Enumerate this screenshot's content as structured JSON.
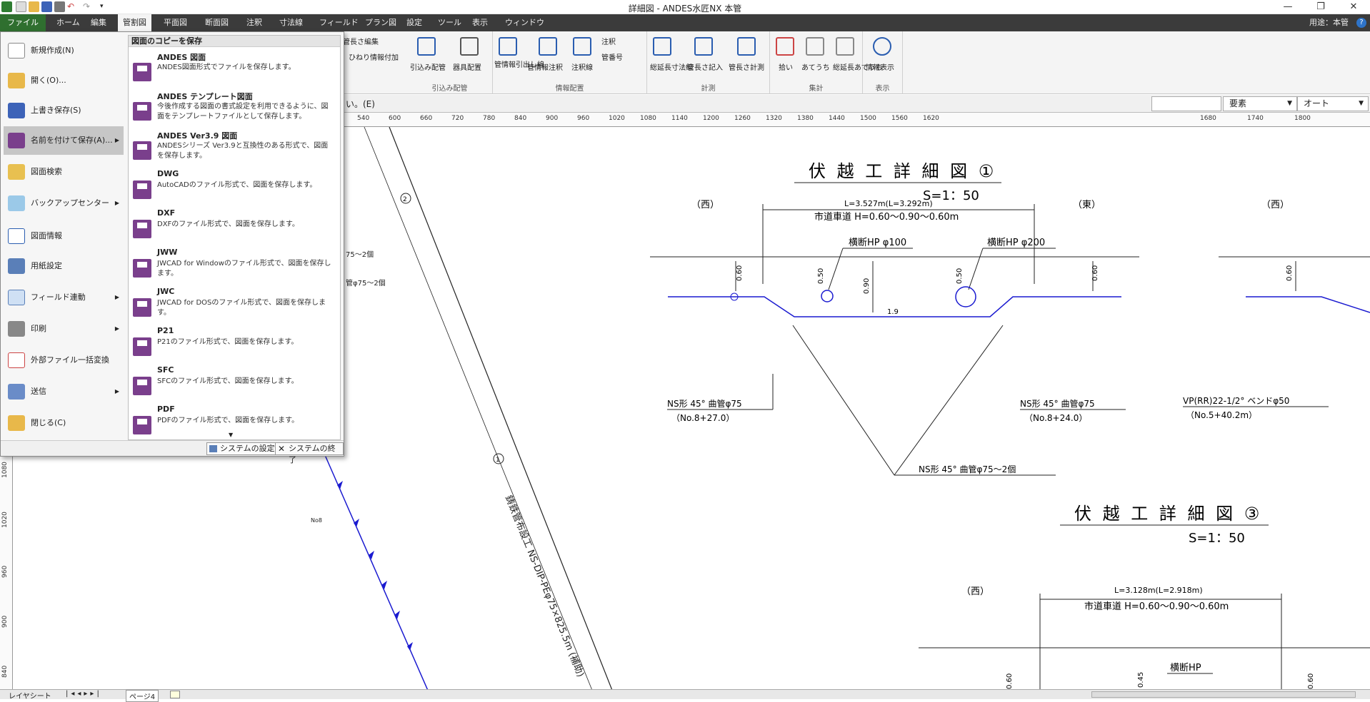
{
  "window": {
    "title": "詳細図 - ANDES水匠NX 本管",
    "minimize": "—",
    "restore": "❐",
    "close": "✕"
  },
  "menu_tabs": [
    "ファイル",
    "ホーム",
    "編集",
    "管割図",
    "平面図",
    "断面図",
    "注釈",
    "寸法線",
    "フィールド",
    "プラン図",
    "設定",
    "ツール",
    "表示",
    "ウィンドウ"
  ],
  "usage_label": "用途：本管",
  "ribbon": {
    "partial_buttons": [
      "管長さ編集",
      "ひねり情報付加"
    ],
    "groups": [
      {
        "title": "引込み配管",
        "buttons": [
          "引込み配管",
          "器具配置"
        ]
      },
      {
        "title": "情報配置",
        "buttons": [
          "管情報引出し線",
          "管情報注釈",
          "注釈線",
          "注釈",
          "管番号"
        ]
      },
      {
        "title": "計測",
        "buttons": [
          "総延長寸法線",
          "管長さ記入",
          "管長さ計測"
        ]
      },
      {
        "title": "集計",
        "buttons": [
          "拾い",
          "あてうち",
          "総延長あてうち"
        ]
      },
      {
        "title": "表示",
        "buttons": [
          "情報表示"
        ]
      }
    ]
  },
  "toolbar2": {
    "prompt_text": "い。(E)",
    "dropdown_element": "要素",
    "dropdown_auto": "オート"
  },
  "ruler_ticks": [
    "540",
    "600",
    "660",
    "720",
    "780",
    "840",
    "900",
    "960",
    "1020",
    "1080",
    "1140",
    "1200",
    "1260",
    "1320",
    "1380",
    "1440",
    "1500",
    "1560",
    "1620",
    "1680",
    "1740",
    "1800"
  ],
  "vruler_ticks": [
    "1080",
    "1020",
    "960",
    "900",
    "840"
  ],
  "file_menu": {
    "left_items": [
      {
        "label": "新規作成(N)",
        "icon": "new-document-icon",
        "submenu": false
      },
      {
        "label": "開く(O)...",
        "icon": "open-folder-icon",
        "submenu": false
      },
      {
        "label": "上書き保存(S)",
        "icon": "save-icon",
        "submenu": false
      },
      {
        "label": "名前を付けて保存(A)...",
        "icon": "save-as-icon",
        "submenu": true
      },
      {
        "label": "図面検索",
        "icon": "search-drawing-icon",
        "submenu": false
      },
      {
        "label": "バックアップセンター",
        "icon": "backup-icon",
        "submenu": true
      },
      {
        "label": "図面情報",
        "icon": "drawing-info-icon",
        "submenu": false
      },
      {
        "label": "用紙設定",
        "icon": "paper-settings-icon",
        "submenu": false
      },
      {
        "label": "フィールド連動",
        "icon": "field-link-icon",
        "submenu": true
      },
      {
        "label": "印刷",
        "icon": "print-icon",
        "submenu": true
      },
      {
        "label": "外部ファイル一括変換",
        "icon": "batch-convert-icon",
        "submenu": false
      },
      {
        "label": "送信",
        "icon": "send-icon",
        "submenu": true
      },
      {
        "label": "閉じる(C)",
        "icon": "close-folder-icon",
        "submenu": false
      }
    ],
    "right_title": "図面のコピーを保存",
    "right_items": [
      {
        "title": "ANDES 図面",
        "desc": "ANDES図面形式でファイルを保存します。"
      },
      {
        "title": "ANDES テンプレート図面",
        "desc": "今後作成する図面の書式設定を利用できるように、図面をテンプレートファイルとして保存します。"
      },
      {
        "title": "ANDES Ver3.9 図面",
        "desc": "ANDESシリーズ Ver3.9と互換性のある形式で、図面を保存します。"
      },
      {
        "title": "DWG",
        "desc": "AutoCADのファイル形式で、図面を保存します。"
      },
      {
        "title": "DXF",
        "desc": "DXFのファイル形式で、図面を保存します。"
      },
      {
        "title": "JWW",
        "desc": "JWCAD for Windowのファイル形式で、図面を保存します。"
      },
      {
        "title": "JWC",
        "desc": "JWCAD for DOSのファイル形式で、図面を保存します。"
      },
      {
        "title": "P21",
        "desc": "P21のファイル形式で、図面を保存します。"
      },
      {
        "title": "SFC",
        "desc": "SFCのファイル形式で、図面を保存します。"
      },
      {
        "title": "PDF",
        "desc": "PDFのファイル形式で、図面を保存します。"
      }
    ],
    "system_settings": "システムの設定",
    "system_exit": "システムの終了"
  },
  "drawing": {
    "title1": "伏 越 工 詳 細 図 ①",
    "scale1": "S=1：50",
    "title3": "伏 越 工 詳 細 図 ③",
    "scale3": "S=1：50",
    "west": "（西）",
    "east": "（東）",
    "dim1": "L=3.527m(L=3.292m)",
    "road1": "市道車道 H=0.60～0.90～0.60m",
    "hp100": "横断HP φ100",
    "hp200": "横断HP φ200",
    "ns45_left": "NS形 45° 曲管φ75",
    "no_left": "（No.8+27.0）",
    "ns45_right": "NS形 45° 曲管φ75",
    "no_right": "（No.8+24.0）",
    "ns45_pair": "NS形 45° 曲管φ75～2個",
    "vp_bend": "VP(RR)22-1/2° ベンドφ50",
    "no_vp": "（No.5+40.2m）",
    "depth_left": "0.60",
    "depth_hp100": "0.50",
    "depth_mid": "0.90",
    "depth_hp200": "0.50",
    "depth_right": "0.60",
    "depth_far": "0.60",
    "depth_row3a": "0.60",
    "depth_row3b": "0.45",
    "depth_row3c": "0.60",
    "span_mid": "1.9",
    "dim3": "L=3.128m(L=2.918m)",
    "road3": "市道車道 H=0.60～0.90～0.60m",
    "hp_bottom": "横断HP",
    "pipe_label": "鋳鉄管布設工 NS-DIP-PEφ75×825.5m (補助)",
    "fragment1": "75～2個",
    "fragment2": "管φ75～2個",
    "no8": "No8",
    "circle2": "2",
    "circle1": "1"
  },
  "status": {
    "layer_sheet": "レイヤシート",
    "page_tab": "ページ4"
  },
  "colors": {
    "menubar": "#3b3b3b",
    "file_tab": "#2f6f2f",
    "pipe_blue": "#1a1ad0",
    "save_purple": "#7a3f8c"
  }
}
